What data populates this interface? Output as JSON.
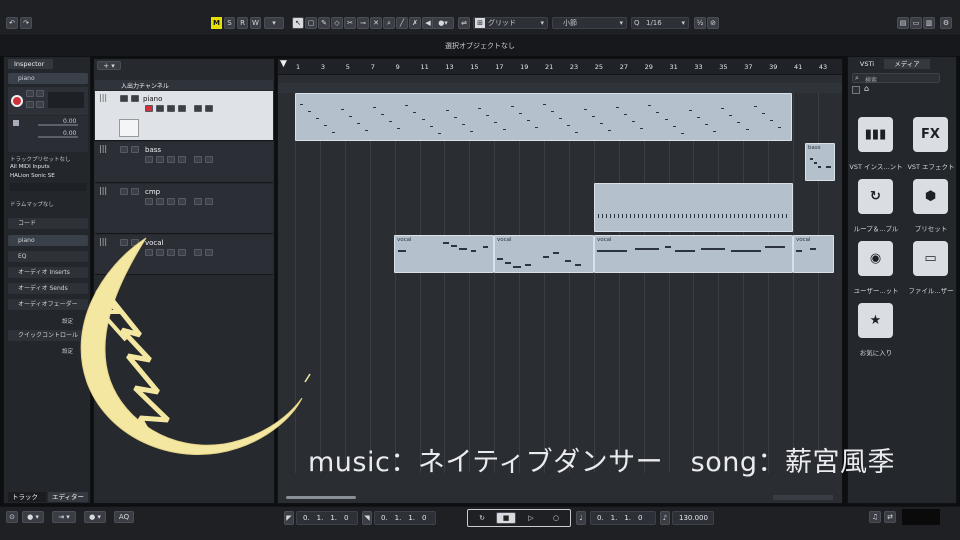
{
  "toolbar": {
    "tool_m": "M",
    "tool_s": "S",
    "tool_r": "R",
    "tool_w": "W",
    "snap_type": "グリッド",
    "snap_label": "小節",
    "quantize": "1/16",
    "status": "選択オブジェクトなし"
  },
  "inspector": {
    "tab": "Inspector",
    "track_name": "piano",
    "vol_value": "0.00",
    "pan_value": "0.00",
    "routing_1": "トラックプリセットなし",
    "routing_2": "All MIDI Inputs",
    "routing_3": "HALion Sonic SE",
    "routing_4": "ドラムマップなし",
    "chord": "コード",
    "section_piano": "piano",
    "eq": "EQ",
    "inserts": "オーディオ Inserts",
    "sends": "オーディオ Sends",
    "fader": "オーディオフェーダー",
    "setting1": "設定",
    "quick": "クイックコントロール",
    "setting2": "設定",
    "bottom_tab_track": "トラック",
    "bottom_tab_editor": "エディター"
  },
  "tracklist": {
    "io_channel": "入出力チャンネル",
    "tracks": [
      "piano",
      "bass",
      "cmp",
      "vocal"
    ]
  },
  "ruler": [
    "1",
    "3",
    "5",
    "7",
    "9",
    "11",
    "13",
    "15",
    "17",
    "19",
    "21",
    "23",
    "25",
    "27",
    "29",
    "31",
    "33",
    "35",
    "37",
    "39",
    "41",
    "43"
  ],
  "parts": {
    "bass_part": "bass",
    "vocal1": "vocal",
    "vocal2": "vocal",
    "vocal3": "vocal",
    "vocal4": "vocal"
  },
  "media": {
    "tab_vsti": "VSTi",
    "tab_media": "メディア",
    "search_placeholder": "検索",
    "tiles": [
      {
        "icon": "piano-icon",
        "label": "VST インス...ント"
      },
      {
        "icon": "fx-icon",
        "glyph": "FX",
        "label": "VST エフェクト"
      },
      {
        "icon": "loop-icon",
        "label": "ループ＆...プル"
      },
      {
        "icon": "preset-icon",
        "label": "プリセット"
      },
      {
        "icon": "user-icon",
        "label": "ユーザー...ット"
      },
      {
        "icon": "file-browser-icon",
        "label": "ファイル...ザー"
      },
      {
        "icon": "star-icon",
        "label": "お気に入り"
      }
    ]
  },
  "transport": {
    "left_locator": "0.　1.　1.　0",
    "right_locator": "0.　1.　1.　0",
    "position": "0.　1.　1.　0",
    "tempo": "130.000",
    "aq": "AQ"
  },
  "overlay": {
    "caption": "music：ネイティブダンサー　song：薪宮風季"
  },
  "colors": {
    "part": "#b4c0cc",
    "record": "#d0303a",
    "accent_m": "#e5e000",
    "moon": "#f3e7a1"
  }
}
